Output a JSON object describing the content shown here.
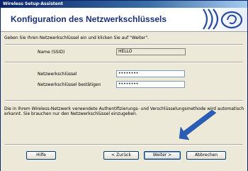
{
  "window": {
    "title": "Wireless Setup-Assistent"
  },
  "header": {
    "title": "Konfiguration des Netzwerkschlüssels",
    "logo_icon": "wireless-signal-logo"
  },
  "main": {
    "instruction": "Geben Sie Ihren Netzwerkschlüssel ein und klicken Sie auf \"Weiter\".",
    "ssid_label": "Name (SSID)",
    "ssid_value": "HELLO",
    "key_label": "Netzwerkschlüssel",
    "key_value": "••••••••",
    "confirm_label": "Netzwerkschlüssel bestätigen",
    "confirm_value": "••••••••",
    "note": "Die in Ihrem Wireless-Netzwerk verwendete Authentifizierungs- und Verschlüsselungsmethode wird automatisch erkannt. Sie brauchen nur den Netzwerkschlüssel einzugeben."
  },
  "buttons": {
    "help": "Hilfe",
    "back": "< Zurück",
    "next": "Weiter >",
    "cancel": "Abbrechen"
  },
  "colors": {
    "title_blue": "#1c2f7a",
    "arrow_blue": "#2a5db8",
    "dialog_bg": "#ece9d8"
  }
}
